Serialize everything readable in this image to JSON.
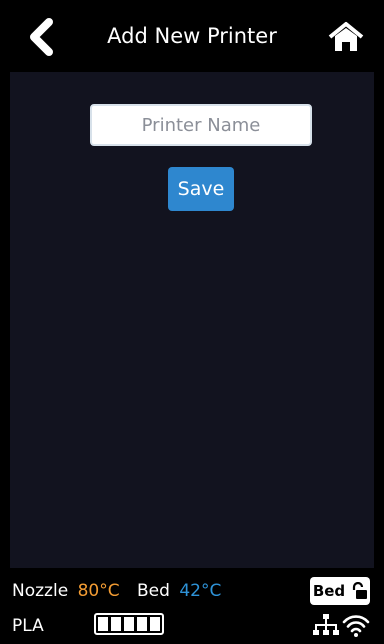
{
  "header": {
    "title": "Add New Printer",
    "back_icon": "chevron-left-icon",
    "home_icon": "home-icon"
  },
  "form": {
    "name_placeholder": "Printer Name",
    "name_value": "",
    "save_label": "Save"
  },
  "status": {
    "nozzle_label": "Nozzle",
    "nozzle_temp": "80°C",
    "bed_label": "Bed",
    "bed_temp": "42°C",
    "bed_badge_label": "Bed",
    "bed_lock_icon": "unlock-icon",
    "material": "PLA",
    "battery_level": 1.0,
    "network_icon": "ethernet-icon",
    "wifi_icon": "wifi-icon"
  },
  "colors": {
    "nozzle_accent": "#f39c33",
    "bed_accent": "#2e93d8",
    "save_button": "#2e87cf",
    "panel_bg": "#12131f"
  }
}
